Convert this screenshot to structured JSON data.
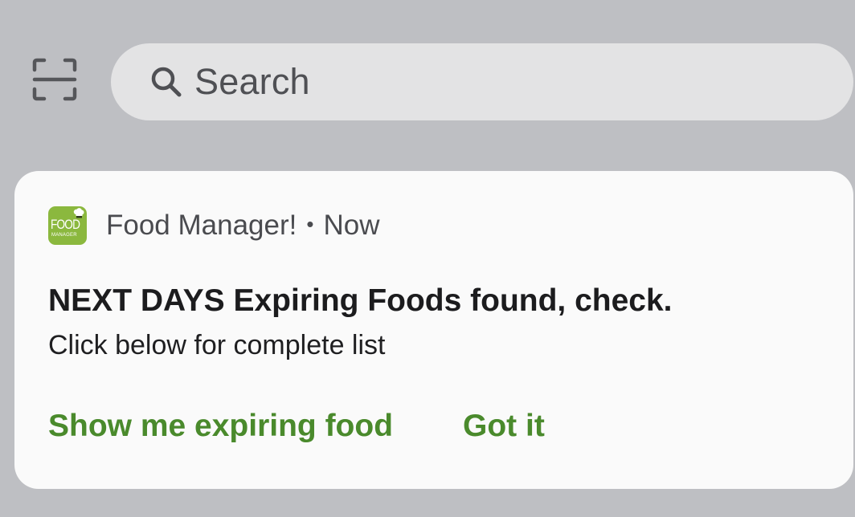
{
  "top_bar": {
    "scan_icon": "scan-frame-icon",
    "search": {
      "icon": "search-icon",
      "placeholder": "Search"
    }
  },
  "notification": {
    "app_icon": {
      "name": "food-manager-app-icon",
      "logo_text": "FOOD",
      "logo_subtext": "MANAGER",
      "color": "#8bb83e"
    },
    "app_name": "Food Manager!",
    "separator": "•",
    "time": "Now",
    "title": "NEXT DAYS Expiring Foods found, check.",
    "body": "Click below for complete list",
    "actions": [
      {
        "label": "Show me expiring food"
      },
      {
        "label": "Got it"
      }
    ],
    "action_color": "#4a8a2c"
  },
  "colors": {
    "background": "#bebfc3",
    "search_bar": "#e3e3e4",
    "card": "#fafafa"
  }
}
